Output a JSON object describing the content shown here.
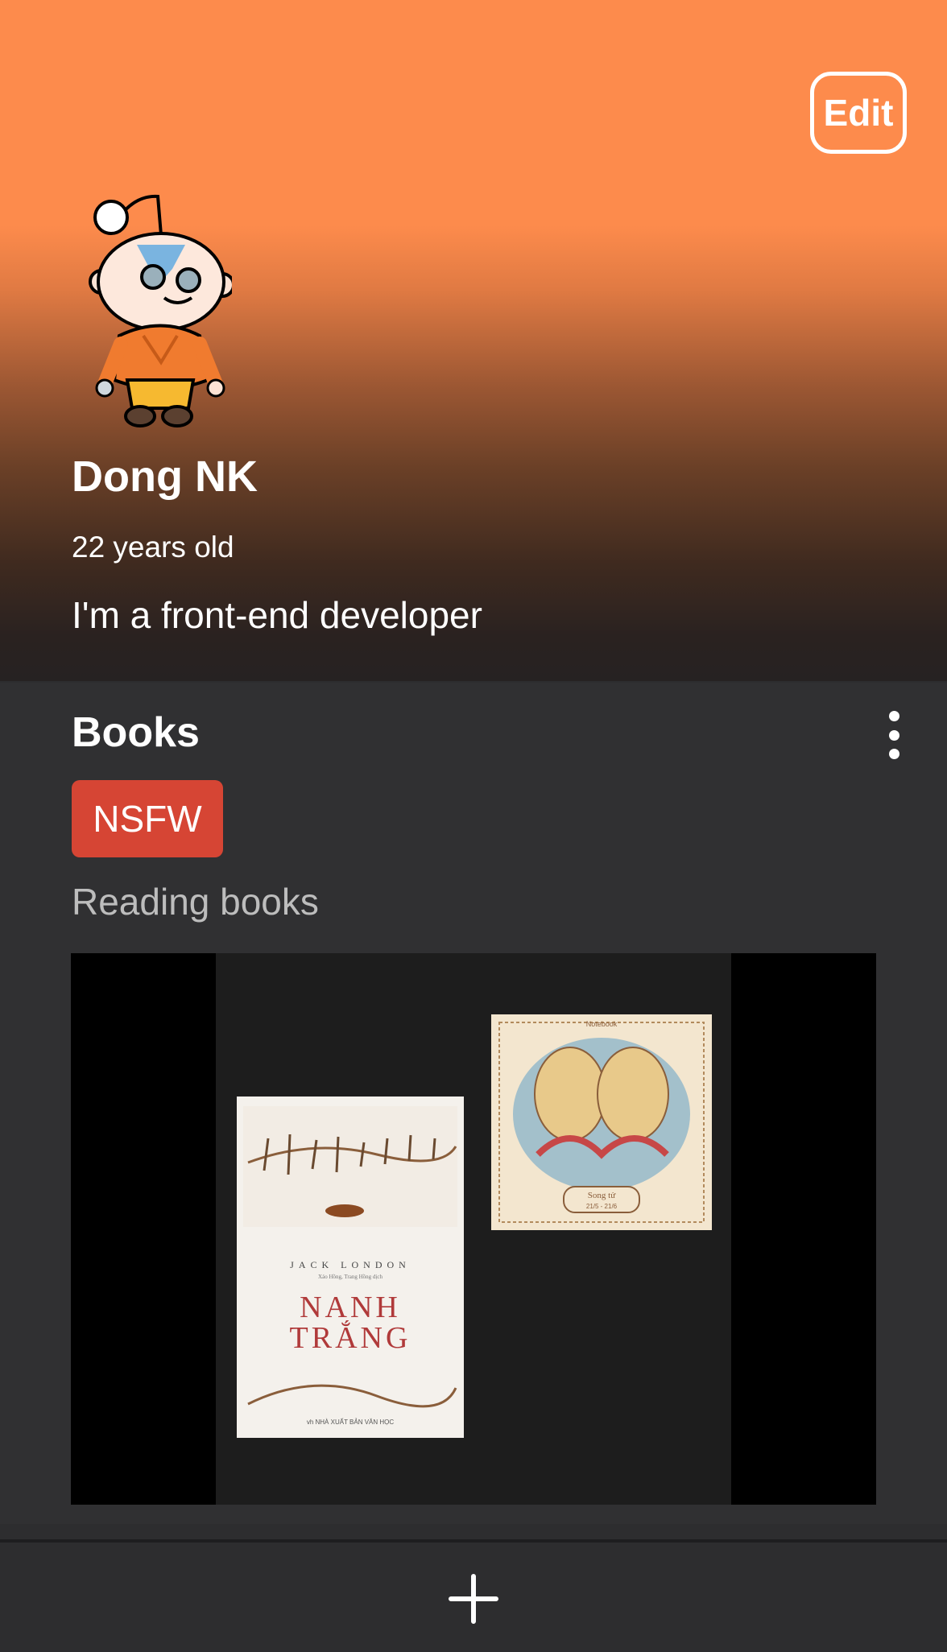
{
  "header": {
    "edit_label": "Edit"
  },
  "profile": {
    "name": "Dong NK",
    "age": "22 years old",
    "bio": "I'm a front-end developer",
    "avatar_icon": "reddit-snoo-avatar"
  },
  "card": {
    "title": "Books",
    "badge": "NSFW",
    "description": "Reading books",
    "more_icon": "more-vertical-icon",
    "image": {
      "book1": {
        "author": "JACK LONDON",
        "translator": "Xảo Hồng, Trang Hồng dịch",
        "title_line1": "NANH",
        "title_line2": "TRẮNG",
        "publisher": "vh NHÀ XUẤT BẢN VĂN HỌC"
      },
      "book2": {
        "label": "Notebook",
        "title": "Song tử",
        "dates": "21/5 - 21/6"
      }
    }
  },
  "bottom": {
    "add_icon": "plus-icon"
  },
  "colors": {
    "header_top": "#fd8b4c",
    "badge": "#d64534",
    "card_bg": "#303032"
  }
}
